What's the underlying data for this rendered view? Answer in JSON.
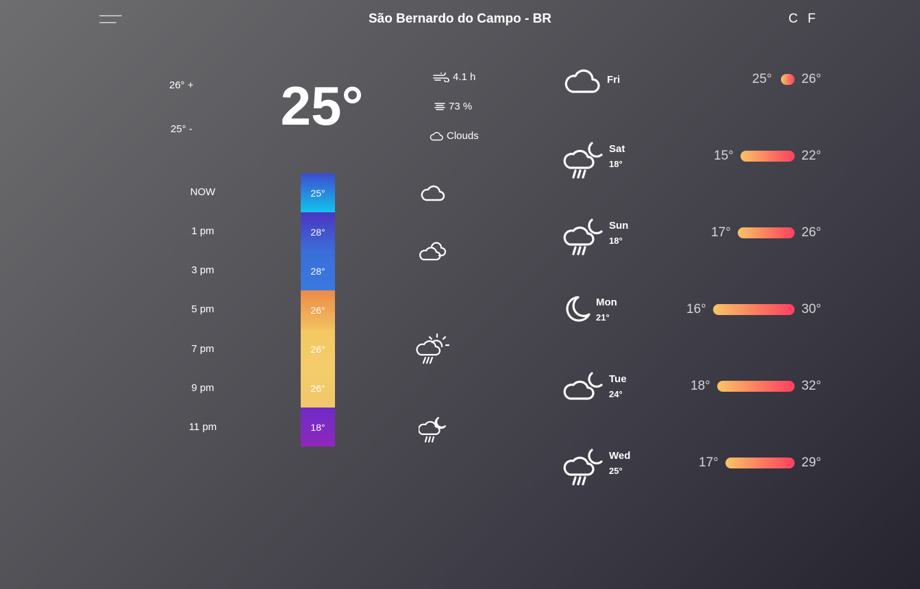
{
  "header": {
    "menu_icon": "hamburger-menu-icon",
    "location": "São Bernardo do Campo - BR",
    "units": [
      "C",
      "F"
    ]
  },
  "current": {
    "temperature": "25°",
    "high": "26° +",
    "low": "25° -",
    "wind": "4.1 h",
    "humidity": "73 %",
    "condition": "Clouds",
    "wind_icon": "wind-icon",
    "humidity_icon": "fog-lines-icon",
    "condition_icon": "cloud-icon"
  },
  "hourly": [
    {
      "time": "NOW",
      "temp": "25°",
      "color_top": "#3e4bd0",
      "color_bottom": "#12c4ee"
    },
    {
      "time": "1 pm",
      "temp": "28°",
      "color_top": "#4a35c0",
      "color_bottom": "#3a6ed8"
    },
    {
      "time": "3 pm",
      "temp": "28°",
      "color_top": "#3a6ed8",
      "color_bottom": "#3a78e0"
    },
    {
      "time": "5 pm",
      "temp": "26°",
      "color_top": "#ec8a48",
      "color_bottom": "#f2c060"
    },
    {
      "time": "7 pm",
      "temp": "26°",
      "color_top": "#f4c862",
      "color_bottom": "#f4cc6a"
    },
    {
      "time": "9 pm",
      "temp": "26°",
      "color_top": "#f4cc6a",
      "color_bottom": "#f2c86a"
    },
    {
      "time": "11 pm",
      "temp": "18°",
      "color_top": "#6e2bc8",
      "color_bottom": "#8e28ba"
    }
  ],
  "hourly_icons": [
    "cloud-icon",
    "cloudy-icon",
    "sun-rain-icon",
    "night-rain-icon"
  ],
  "daily": [
    {
      "day": "Fri",
      "night": "",
      "low": "25°",
      "high": "26°",
      "icon": "cloud-icon",
      "range_low": 25,
      "range_high": 26
    },
    {
      "day": "Sat",
      "night": "18°",
      "low": "15°",
      "high": "22°",
      "icon": "night-rain-icon",
      "range_low": 15,
      "range_high": 22
    },
    {
      "day": "Sun",
      "night": "18°",
      "low": "17°",
      "high": "26°",
      "icon": "night-rain-icon",
      "range_low": 17,
      "range_high": 26
    },
    {
      "day": "Mon",
      "night": "21°",
      "low": "16°",
      "high": "30°",
      "icon": "moon-icon",
      "range_low": 16,
      "range_high": 30
    },
    {
      "day": "Tue",
      "night": "24°",
      "low": "18°",
      "high": "32°",
      "icon": "night-cloud-icon",
      "range_low": 18,
      "range_high": 32
    },
    {
      "day": "Wed",
      "night": "25°",
      "low": "17°",
      "high": "29°",
      "icon": "night-rain-icon",
      "range_low": 17,
      "range_high": 29
    }
  ]
}
